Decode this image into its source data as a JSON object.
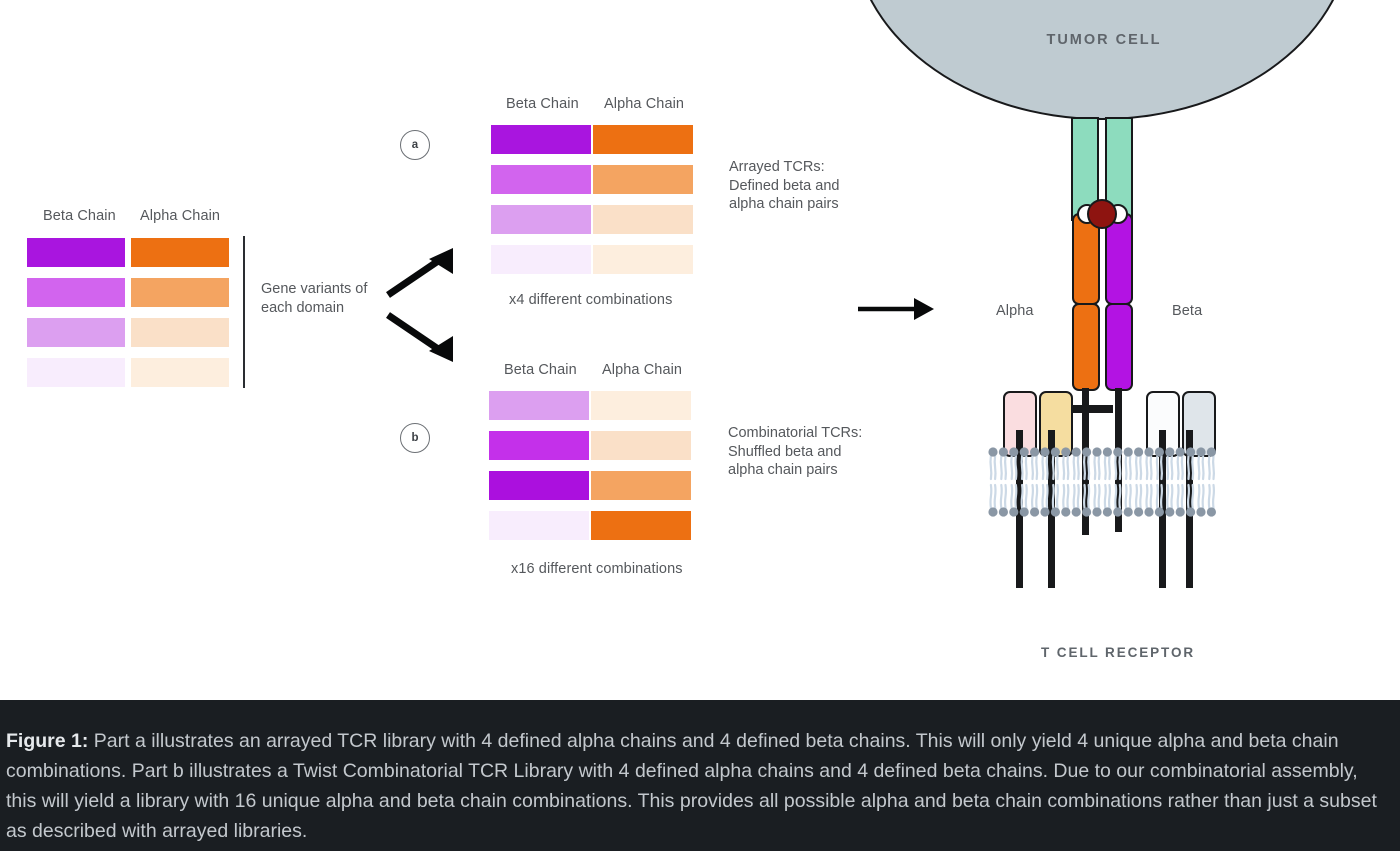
{
  "figure": {
    "colors": {
      "beta_1": "#a915df",
      "beta_2": "#d264ee",
      "beta_3": "#dc9ff0",
      "beta_4": "#f8edfd",
      "alpha_1": "#ed7012",
      "alpha_2": "#f4a461",
      "alpha_3": "#fae0c8",
      "alpha_4": "#fdeede",
      "tumor_fill": "#bfcbd1",
      "mhc_fill": "#8ddcbe",
      "antigen_fill": "#8e1410",
      "cd3_pink": "#fadde0",
      "cd3_tan": "#f5dda0",
      "cd3_white": "#fbfcfd",
      "cd3_gray": "#dfe5ea",
      "outline": "#18191b",
      "text_gray": "#55585c"
    },
    "left_panel": {
      "header_beta": "Beta Chain",
      "header_alpha": "Alpha Chain",
      "note": "Gene variants of\neach domain",
      "beta_rows": [
        "#a915df",
        "#d264ee",
        "#dc9ff0",
        "#f8edfd"
      ],
      "alpha_rows": [
        "#ed7012",
        "#f4a461",
        "#fae0c8",
        "#fdeede"
      ]
    },
    "panel_a": {
      "marker": "a",
      "header_beta": "Beta Chain",
      "header_alpha": "Alpha Chain",
      "beta_rows": [
        "#a915df",
        "#d264ee",
        "#dc9ff0",
        "#f8edfd"
      ],
      "alpha_rows": [
        "#ed7012",
        "#f4a461",
        "#fae0c8",
        "#fdeede"
      ],
      "footer": "x4 different combinations",
      "description": "Arrayed TCRs:\nDefined beta and\nalpha chain pairs"
    },
    "panel_b": {
      "marker": "b",
      "header_beta": "Beta Chain",
      "header_alpha": "Alpha Chain",
      "beta_rows": [
        "#dc9ff0",
        "#c430ea",
        "#ab10de",
        "#f8edfd"
      ],
      "alpha_rows": [
        "#fdeede",
        "#fae0c8",
        "#f4a461",
        "#ed7012"
      ],
      "footer": "x16 different combinations",
      "description": "Combinatorial TCRs:\nShuffled beta and\nalpha chain pairs"
    },
    "cell_diagram": {
      "tumor_label": "TUMOR CELL",
      "alpha_label": "Alpha",
      "beta_label": "Beta",
      "receptor_label": "T CELL RECEPTOR"
    }
  },
  "caption": {
    "prefix": "Figure 1:",
    "body": " Part a illustrates an arrayed TCR library with 4 defined alpha chains and 4 defined beta chains. This will only yield 4 unique alpha and beta chain combinations. Part b illustrates a Twist Combinatorial TCR Library with 4 defined alpha chains and 4 defined beta chains. Due to our combinatorial assembly, this will yield a library with 16 unique alpha and beta chain combinations. This provides all possible alpha and beta chain combinations rather than just a subset as described with arrayed libraries."
  }
}
